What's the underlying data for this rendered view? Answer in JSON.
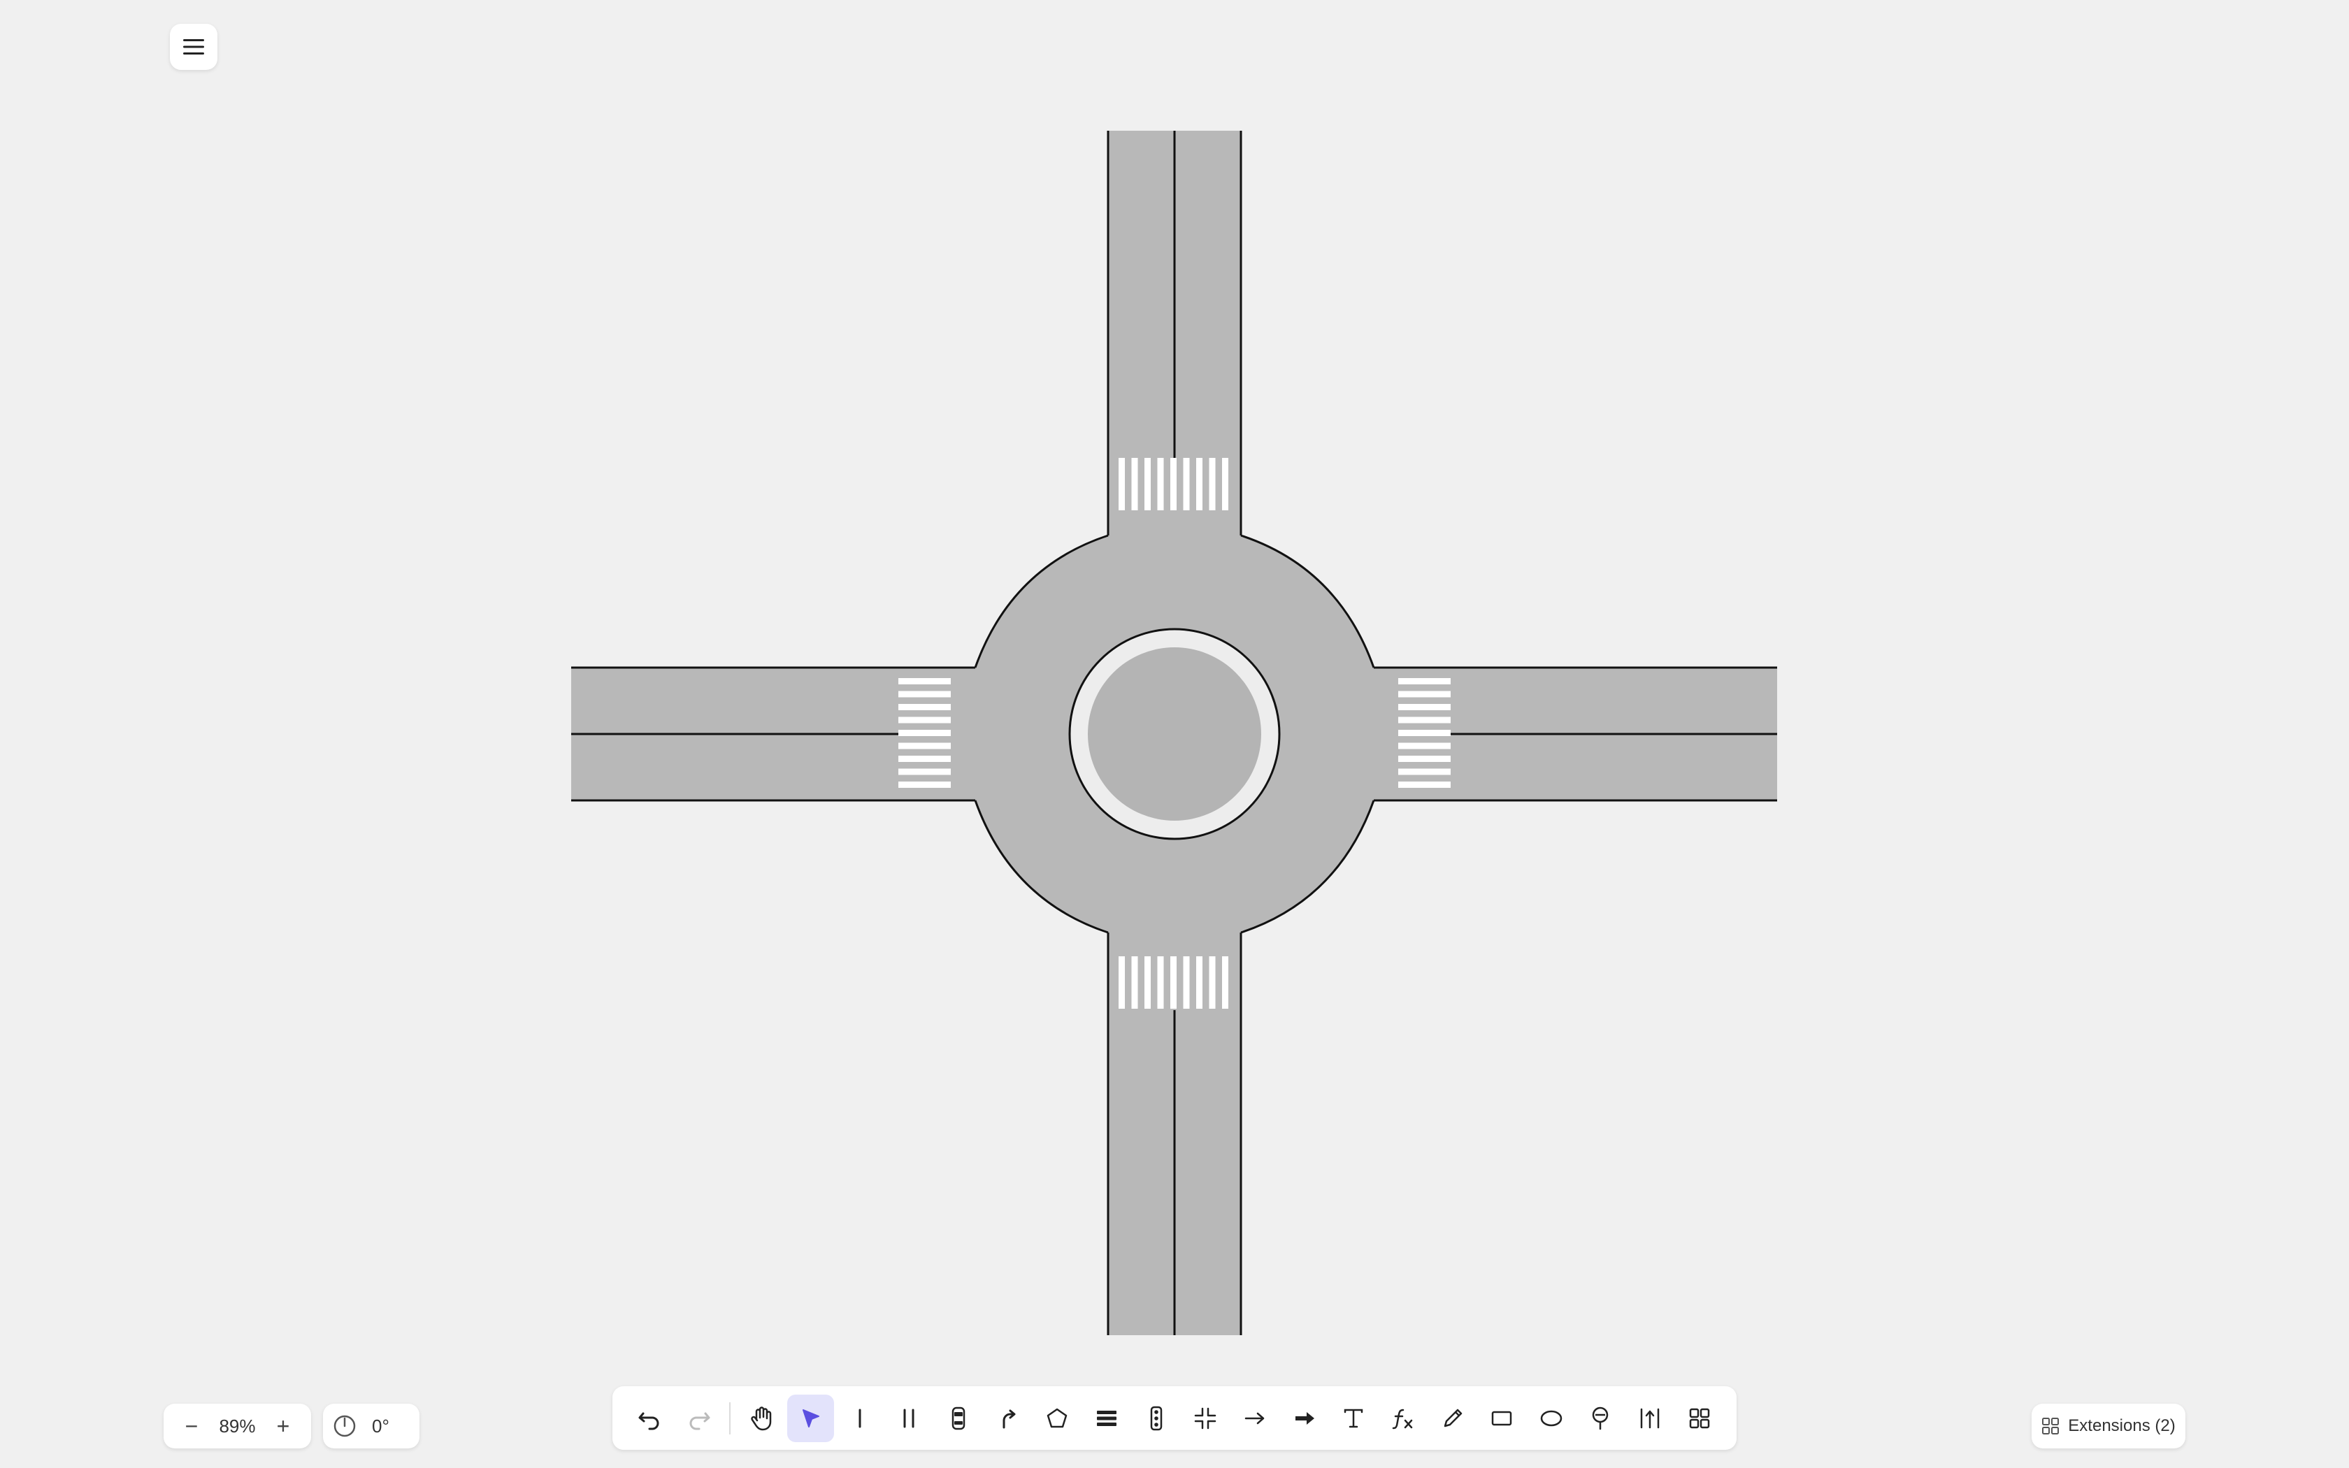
{
  "app": {
    "menu_icon": "hamburger-menu-icon"
  },
  "zoom": {
    "level": "89%",
    "minus": "−",
    "plus": "+"
  },
  "rotation": {
    "value": "0°",
    "icon": "compass-icon"
  },
  "toolbar": {
    "tools": [
      {
        "name": "undo-icon",
        "active": false
      },
      {
        "name": "redo-icon",
        "active": false,
        "disabled": true
      },
      {
        "name": "pan-hand-icon",
        "active": false
      },
      {
        "name": "select-arrow-icon",
        "active": true
      },
      {
        "name": "single-line-icon",
        "active": false
      },
      {
        "name": "double-line-icon",
        "active": false
      },
      {
        "name": "car-icon",
        "active": false
      },
      {
        "name": "curved-arrow-icon",
        "active": false
      },
      {
        "name": "polygon-icon",
        "active": false
      },
      {
        "name": "lanes-icon",
        "active": false
      },
      {
        "name": "traffic-light-icon",
        "active": false
      },
      {
        "name": "merge-icon",
        "active": false
      },
      {
        "name": "thin-arrow-icon",
        "active": false
      },
      {
        "name": "thick-arrow-icon",
        "active": false
      },
      {
        "name": "text-icon",
        "active": false
      },
      {
        "name": "function-icon",
        "active": false
      },
      {
        "name": "pencil-icon",
        "active": false
      },
      {
        "name": "rectangle-icon",
        "active": false
      },
      {
        "name": "ellipse-icon",
        "active": false
      },
      {
        "name": "pin-icon",
        "active": false
      },
      {
        "name": "measure-icon",
        "active": false
      },
      {
        "name": "grid-icon",
        "active": false
      }
    ]
  },
  "extensions": {
    "label": "Extensions (2)",
    "icon": "extensions-grid-icon"
  },
  "colors": {
    "background": "#f0f0f0",
    "road": "#b8b8b8",
    "island": "#b4b4b4",
    "island_ring": "#ededed",
    "line": "#111111",
    "marking": "#ffffff",
    "accent": "#5b4fe0"
  }
}
